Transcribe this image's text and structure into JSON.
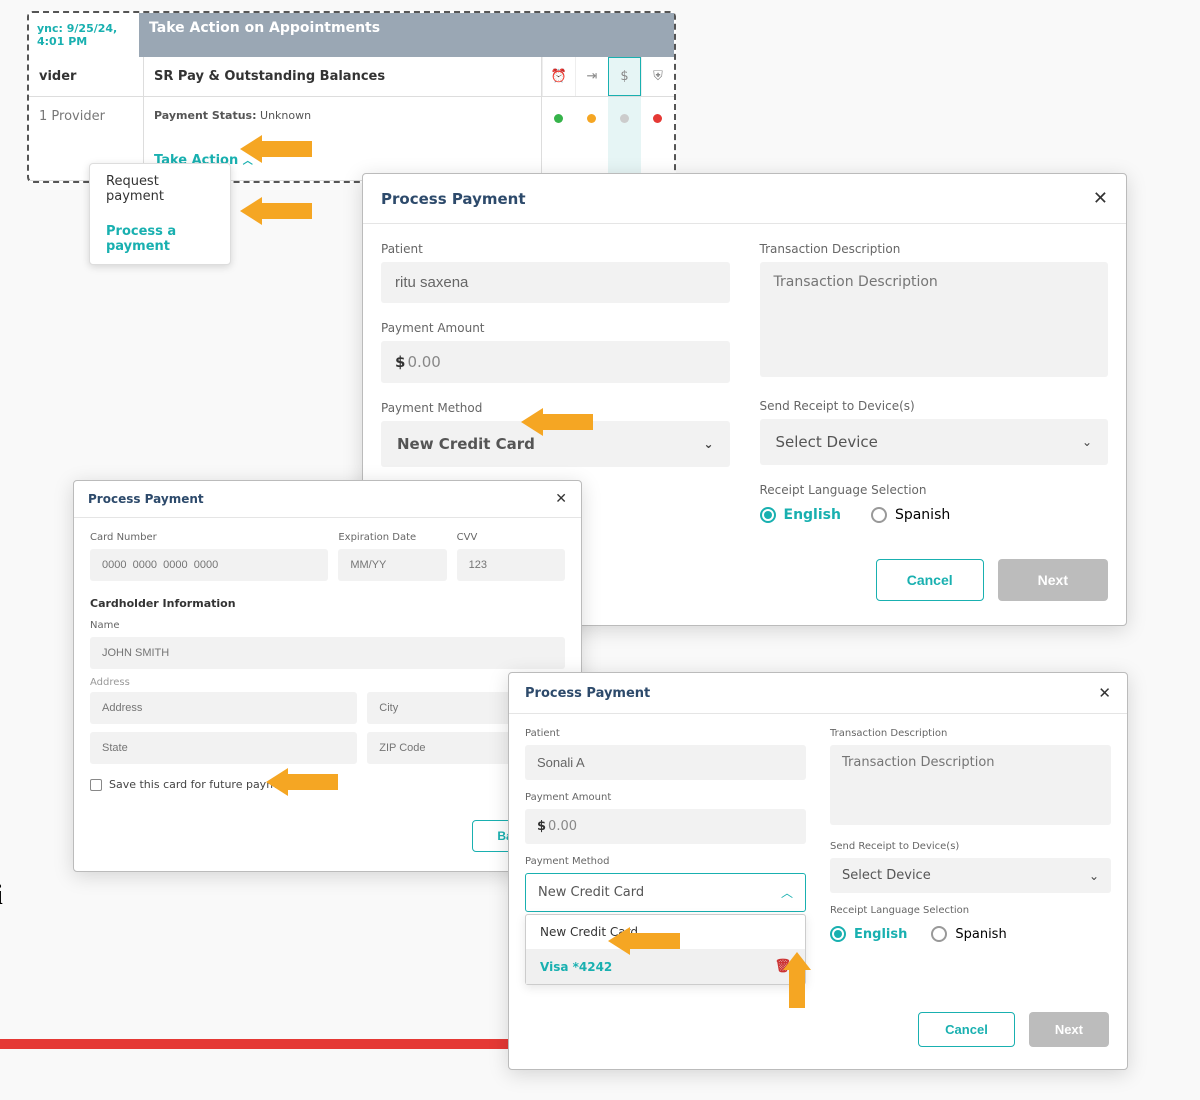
{
  "panel1": {
    "sync": "ync: 9/25/24, 4:01 PM",
    "headerTitle": "Take Action on Appointments",
    "colA": "vider",
    "colB": "SR Pay & Outstanding Balances",
    "providerCell": "1 Provider",
    "paymentStatusLabel": "Payment Status:",
    "paymentStatusValue": "Unknown",
    "takeAction": "Take Action"
  },
  "dropdown": {
    "opt1": "Request payment",
    "opt2": "Process a payment"
  },
  "modal2": {
    "title": "Process Payment",
    "patientLabel": "Patient",
    "patientValue": "ritu saxena",
    "txnLabel": "Transaction Description",
    "txnPlaceholder": "Transaction Description",
    "amountLabel": "Payment Amount",
    "amountCurrency": "$",
    "amountValue": "0.00",
    "pmLabel": "Payment Method",
    "pmValue": "New Credit Card",
    "deviceLabel": "Send Receipt to Device(s)",
    "deviceValue": "Select Device",
    "langLabel": "Receipt Language Selection",
    "langEnglish": "English",
    "langSpanish": "Spanish",
    "cancel": "Cancel",
    "next": "Next"
  },
  "modal3": {
    "title": "Process Payment",
    "cardNumberLabel": "Card Number",
    "cardNumberPh": "0000  0000  0000  0000",
    "expLabel": "Expiration Date",
    "expPh": "MM/YY",
    "cvvLabel": "CVV",
    "cvvPh": "123",
    "cardholderHdr": "Cardholder Information",
    "nameLabel": "Name",
    "namePh": "JOHN SMITH",
    "addressPh": "Address",
    "cityPh": "City",
    "statePh": "State",
    "zipPh": "ZIP Code",
    "saveCard": "Save this card for future payments",
    "back": "Back"
  },
  "modal4": {
    "title": "Process Payment",
    "patientLabel": "Patient",
    "patientValue": "Sonali A",
    "txnLabel": "Transaction Description",
    "txnPlaceholder": "Transaction Description",
    "amountLabel": "Payment Amount",
    "amountCurrency": "$",
    "amountValue": "0.00",
    "pmLabel": "Payment Method",
    "pmValue": "New Credit Card",
    "pmOpt1": "New Credit Card",
    "pmOpt2": "Visa *4242",
    "deviceLabel": "Send Receipt to Device(s)",
    "deviceValue": "Select Device",
    "langLabel": "Receipt Language Selection",
    "langEnglish": "English",
    "langSpanish": "Spanish",
    "cancel": "Cancel",
    "next": "Next"
  },
  "footerChar": "i"
}
